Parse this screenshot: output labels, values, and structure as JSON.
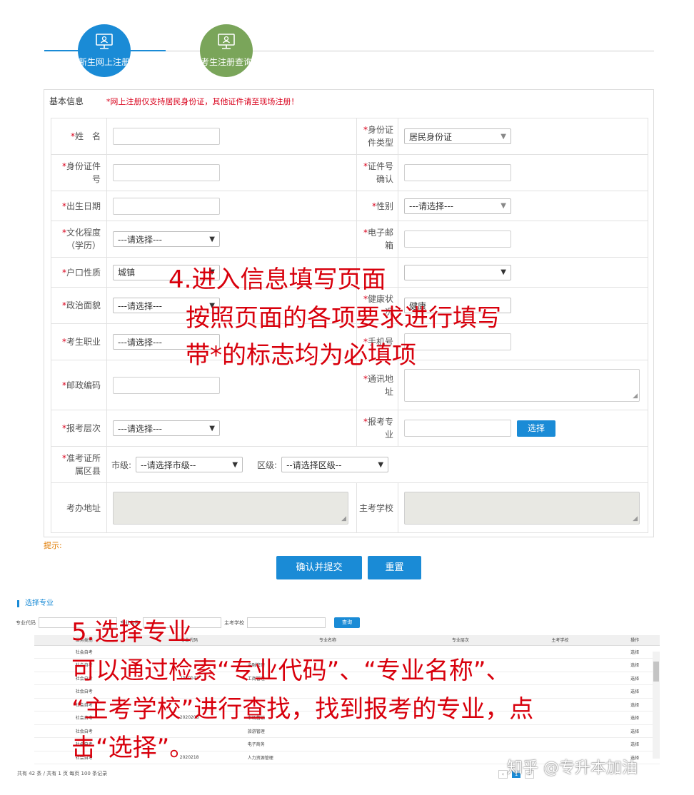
{
  "steps": [
    {
      "label": "新生网上注册",
      "icon": "monitor-icon",
      "color": "#1a8bd6"
    },
    {
      "label": "考生注册查询",
      "icon": "monitor-icon",
      "color": "#7aa55a"
    }
  ],
  "form": {
    "section_title": "基本信息",
    "notice": "*网上注册仅支持居民身份证，其他证件请至现场注册！",
    "required_mark": "*",
    "fields": {
      "name_label": "姓　名",
      "id_type_label": "身份证件类型",
      "id_type_value": "居民身份证",
      "id_number_label": "身份证件号",
      "id_confirm_label": "证件号确认",
      "birth_label": "出生日期",
      "gender_label": "性别",
      "gender_value": "---请选择---",
      "education_label": "文化程度（学历）",
      "education_value": "---请选择---",
      "email_label": "电子邮箱",
      "hukou_label": "户口性质",
      "hukou_value": "城镇",
      "politics_label": "政治面貌",
      "politics_value": "---请选择---",
      "health_label": "健康状况",
      "health_value": "健康",
      "job_label": "考生职业",
      "job_value": "---请选择---",
      "phone_label": "手机号",
      "postcode_label": "邮政编码",
      "address_label": "通讯地址",
      "level_label": "报考层次",
      "level_value": "---请选择---",
      "major_label": "报考专业",
      "major_button": "选择",
      "district_label": "准考证所属区县",
      "city_label": "市级:",
      "city_value": "--请选择市级--",
      "area_label": "区级:",
      "area_value": "--请选择区级--",
      "office_address_label": "考办地址",
      "school_label": "主考学校"
    },
    "hint": "提示:",
    "submit": "确认并提交",
    "reset": "重置"
  },
  "annotations": {
    "step4_line1": "4.进入信息填写页面",
    "step4_line2": "按照页面的各项要求进行填写",
    "step4_line3": "带*的标志均为必填项",
    "step5_line1": "5.选择专业",
    "step5_line2": "可以通过检索“专业代码”、“专业名称”、",
    "step5_line3": "“主考学校”进行查找，找到报考的专业，点",
    "step5_line4": "击“选择”。",
    "color": "#d8000c"
  },
  "picker": {
    "title": "选择专业",
    "code_label": "专业代码",
    "name_label": "专业名称",
    "school_label": "主考学校",
    "query_button": "查询",
    "columns": [
      "业务类别",
      "专业代码",
      "专业名称",
      "专业层次",
      "主考学校",
      "操作"
    ],
    "rows": [
      [
        "社会自考",
        "",
        "",
        "",
        "",
        "选择"
      ],
      [
        "社会自考",
        "",
        "金融管理",
        "",
        "",
        "选择"
      ],
      [
        "社会自考",
        "2020142",
        "工商管理",
        "",
        "",
        "选择"
      ],
      [
        "社会自考",
        "",
        "",
        "",
        "",
        "选择"
      ],
      [
        "社会自考",
        "",
        "",
        "",
        "",
        "选择"
      ],
      [
        "社会自考",
        "2020208",
        "市场营销",
        "",
        "",
        "选择"
      ],
      [
        "社会自考",
        "",
        "旅游管理",
        "",
        "",
        "选择"
      ],
      [
        "社会自考",
        "",
        "电子商务",
        "",
        "",
        "选择"
      ],
      [
        "社会自考",
        "2020218",
        "人力资源管理",
        "",
        "",
        "选择"
      ]
    ],
    "footer": "共有 42 条 / 共有 1 页 每页 100 条记录",
    "pager_current": "1"
  },
  "watermark": "知乎 @专升本加油"
}
